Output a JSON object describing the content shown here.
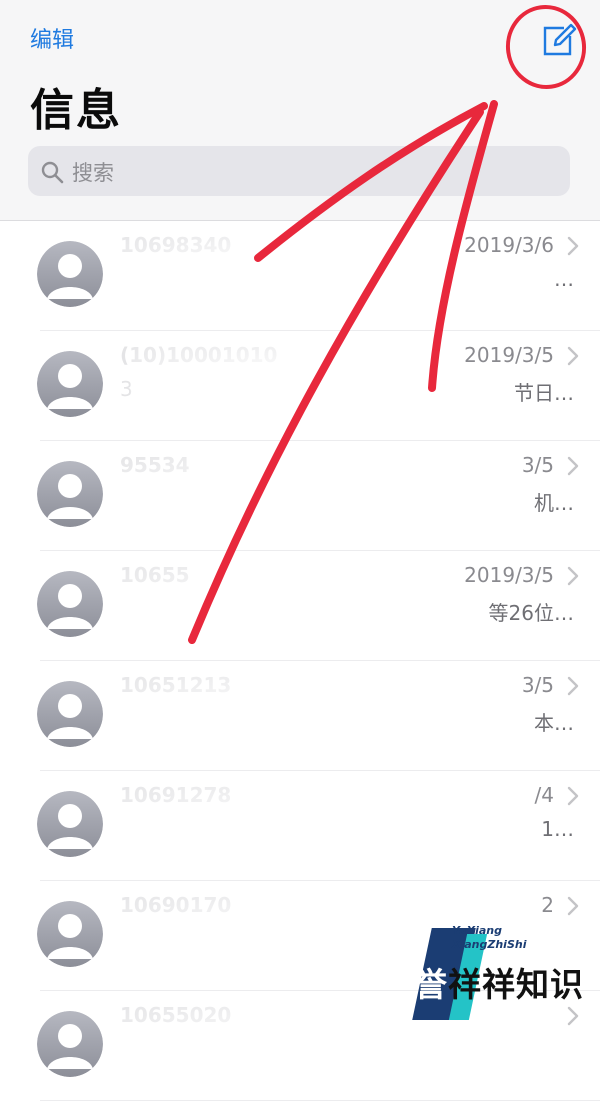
{
  "header": {
    "edit_label": "编辑",
    "title": "信息",
    "search_placeholder": "搜索",
    "accent_color": "#1f7ae0"
  },
  "icons": {
    "compose": "compose-icon",
    "search": "search-icon",
    "chevron": "chevron-right-icon",
    "avatar": "person-avatar-icon"
  },
  "conversations": [
    {
      "sender": "10698340",
      "date": "2019/3/6",
      "preview": "",
      "preview_end": "…"
    },
    {
      "sender": "(10)10001010",
      "date": "2019/3/5",
      "preview": "3",
      "preview_end": "节日…"
    },
    {
      "sender": "95534",
      "date": "3/5",
      "preview": "",
      "preview_end": "机…"
    },
    {
      "sender": "10655",
      "date": "2019/3/5",
      "preview": "",
      "preview_end": "等26位…"
    },
    {
      "sender": "10651213",
      "date": "3/5",
      "preview": "",
      "preview_end": "本…"
    },
    {
      "sender": "10691278",
      "date": "/4",
      "preview": "",
      "preview_end": "1…"
    },
    {
      "sender": "10690170",
      "date": "2",
      "preview": "",
      "preview_end": ""
    },
    {
      "sender": "10655020",
      "date": "",
      "preview": "",
      "preview_end": ""
    }
  ],
  "watermark": {
    "small_line1": "YuXiang",
    "small_line2": "XiangZhiShi",
    "main_first": "誉",
    "main_rest": "祥祥知识"
  },
  "annotation_color": "#e8283c"
}
